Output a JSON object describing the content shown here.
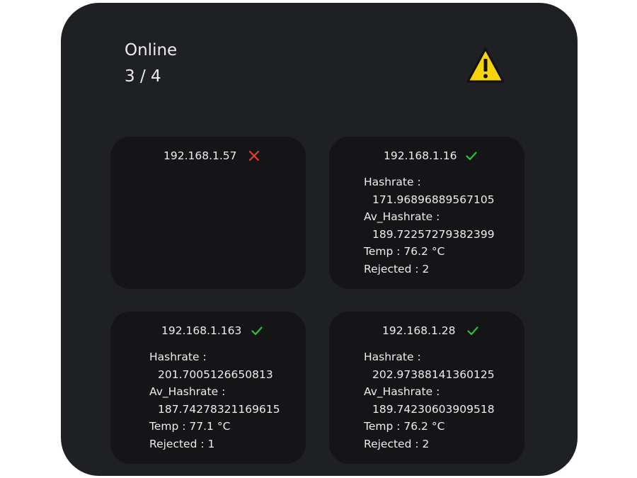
{
  "header": {
    "online_label": "Online",
    "online_count": "3 / 4",
    "alert_icon": "warning-triangle-icon",
    "alert_color": "#f5d40a"
  },
  "colors": {
    "background": "#1f2024",
    "card": "#151518",
    "ok": "#2fbf3a",
    "error": "#e2402a"
  },
  "miners": [
    {
      "ip": "192.168.1.57",
      "status": "offline",
      "status_icon": "cross-icon"
    },
    {
      "ip": "192.168.1.16",
      "status": "online",
      "status_icon": "check-icon",
      "hashrate_label": "Hashrate :",
      "hashrate": "171.96896889567105",
      "av_hashrate_label": "Av_Hashrate :",
      "av_hashrate": "189.72257279382399",
      "temp": "Temp : 76.2 °C",
      "rejected": "Rejected : 2"
    },
    {
      "ip": "192.168.1.163",
      "status": "online",
      "status_icon": "check-icon",
      "hashrate_label": "Hashrate :",
      "hashrate": "201.7005126650813",
      "av_hashrate_label": "Av_Hashrate :",
      "av_hashrate": "187.74278321169615",
      "temp": "Temp : 77.1 °C",
      "rejected": "Rejected : 1"
    },
    {
      "ip": "192.168.1.28",
      "status": "online",
      "status_icon": "check-icon",
      "hashrate_label": "Hashrate :",
      "hashrate": "202.97388141360125",
      "av_hashrate_label": "Av_Hashrate :",
      "av_hashrate": "189.74230603909518",
      "temp": "Temp : 76.2 °C",
      "rejected": "Rejected : 2"
    }
  ]
}
